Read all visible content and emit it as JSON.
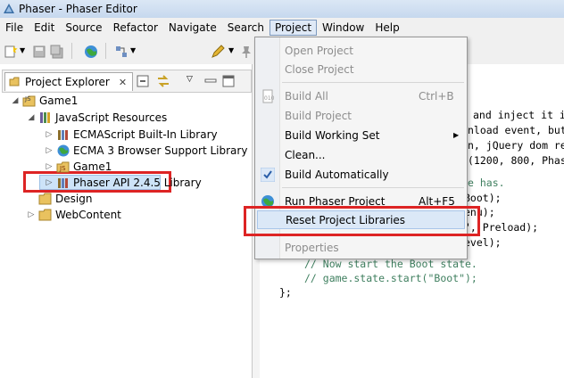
{
  "window": {
    "title": "Phaser - Phaser Editor"
  },
  "menubar": {
    "items": [
      "File",
      "Edit",
      "Source",
      "Refactor",
      "Navigate",
      "Search",
      "Project",
      "Window",
      "Help"
    ],
    "active": "Project"
  },
  "explorer": {
    "tab_label": "Project Explorer",
    "tree": [
      {
        "label": "Game1",
        "icon": "project-icon"
      },
      {
        "label": "JavaScript Resources",
        "icon": "js-resources-icon",
        "selected": true
      },
      {
        "label": "ECMAScript Built-In Library",
        "icon": "library-icon"
      },
      {
        "label": "ECMA 3 Browser Support Library",
        "icon": "browser-library-icon"
      },
      {
        "label": "Game1",
        "icon": "source-folder-icon"
      },
      {
        "label": "Phaser API 2.4.5 Library",
        "icon": "library-icon"
      },
      {
        "label": "Design",
        "icon": "folder-icon"
      },
      {
        "label": "WebContent",
        "icon": "folder-icon"
      }
    ]
  },
  "project_menu": {
    "items": [
      {
        "label": "Open Project",
        "enabled": false
      },
      {
        "label": "Close Project",
        "enabled": false
      },
      {
        "label": "Build All",
        "shortcut": "Ctrl+B",
        "enabled": false
      },
      {
        "label": "Build Project",
        "enabled": false
      },
      {
        "label": "Build Working Set",
        "enabled": true,
        "submenu": true
      },
      {
        "label": "Clean...",
        "enabled": true
      },
      {
        "label": "Build Automatically",
        "enabled": true,
        "checked": true
      },
      {
        "label": "Run Phaser Project",
        "shortcut": "Alt+F5",
        "enabled": true
      },
      {
        "label": "Reset Project Libraries",
        "enabled": true,
        "highlighted": true
      },
      {
        "label": "Properties",
        "enabled": false
      }
    ]
  },
  "editor": {
    "lines": [
      "and inject it i",
      "nload event, but",
      "n, jQuery dom re",
      "(1200, 800, Phas",
      "e has.",
      "Boot);",
      "enu);",
      "\", Preload);",
      "evel);",
      "// Now start the Boot state.",
      "// game.state.start(\"Boot\");",
      "};"
    ]
  },
  "colors": {
    "highlight_border": "#dd2424",
    "selection": "#cde3f8",
    "comment": "#3f7f5f"
  }
}
